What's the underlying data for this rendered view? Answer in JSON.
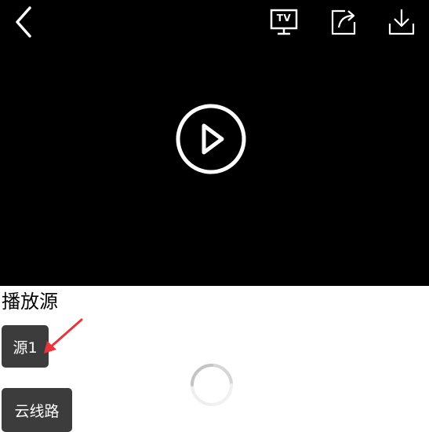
{
  "player": {
    "tv_label": "TV"
  },
  "sources": {
    "title": "播放源",
    "items": [
      {
        "label": "源1"
      },
      {
        "label": "云线路"
      }
    ]
  },
  "colors": {
    "player_background": "#000000",
    "button_background": "#3c3c3c",
    "annotation_arrow": "#e8343b"
  },
  "icons": [
    "back-icon",
    "tv-cast-icon",
    "share-icon",
    "download-icon",
    "play-icon",
    "loading-spinner-icon",
    "annotation-arrow-icon"
  ]
}
